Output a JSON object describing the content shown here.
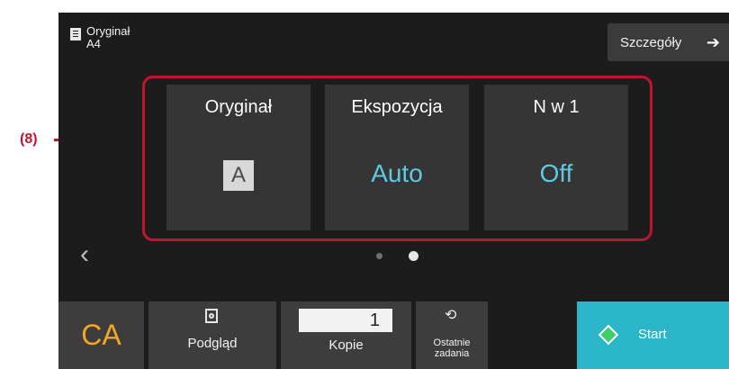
{
  "callout": {
    "label": "(8)"
  },
  "header": {
    "original_label": "Oryginał",
    "original_size": "A4",
    "details_button": "Szczegóły",
    "details_arrow": "➔"
  },
  "tiles": [
    {
      "title": "Oryginał",
      "value": "A"
    },
    {
      "title": "Ekspozycja",
      "value": "Auto"
    },
    {
      "title": "N w 1",
      "value": "Off"
    }
  ],
  "pager": {
    "prev_icon": "‹",
    "active_page": 2,
    "page_count": 2
  },
  "bottom": {
    "ca_label": "CA",
    "preview_label": "Podgląd",
    "copies_value": "1",
    "copies_label": "Kopie",
    "recent_label": "Ostatnie zadania",
    "recent_icon": "⟲",
    "start_label": "Start"
  },
  "colors": {
    "accent_value": "#5fc8e2",
    "callout": "#c0152f",
    "ca": "#f5a623",
    "start_bg": "#2bb5c8"
  }
}
